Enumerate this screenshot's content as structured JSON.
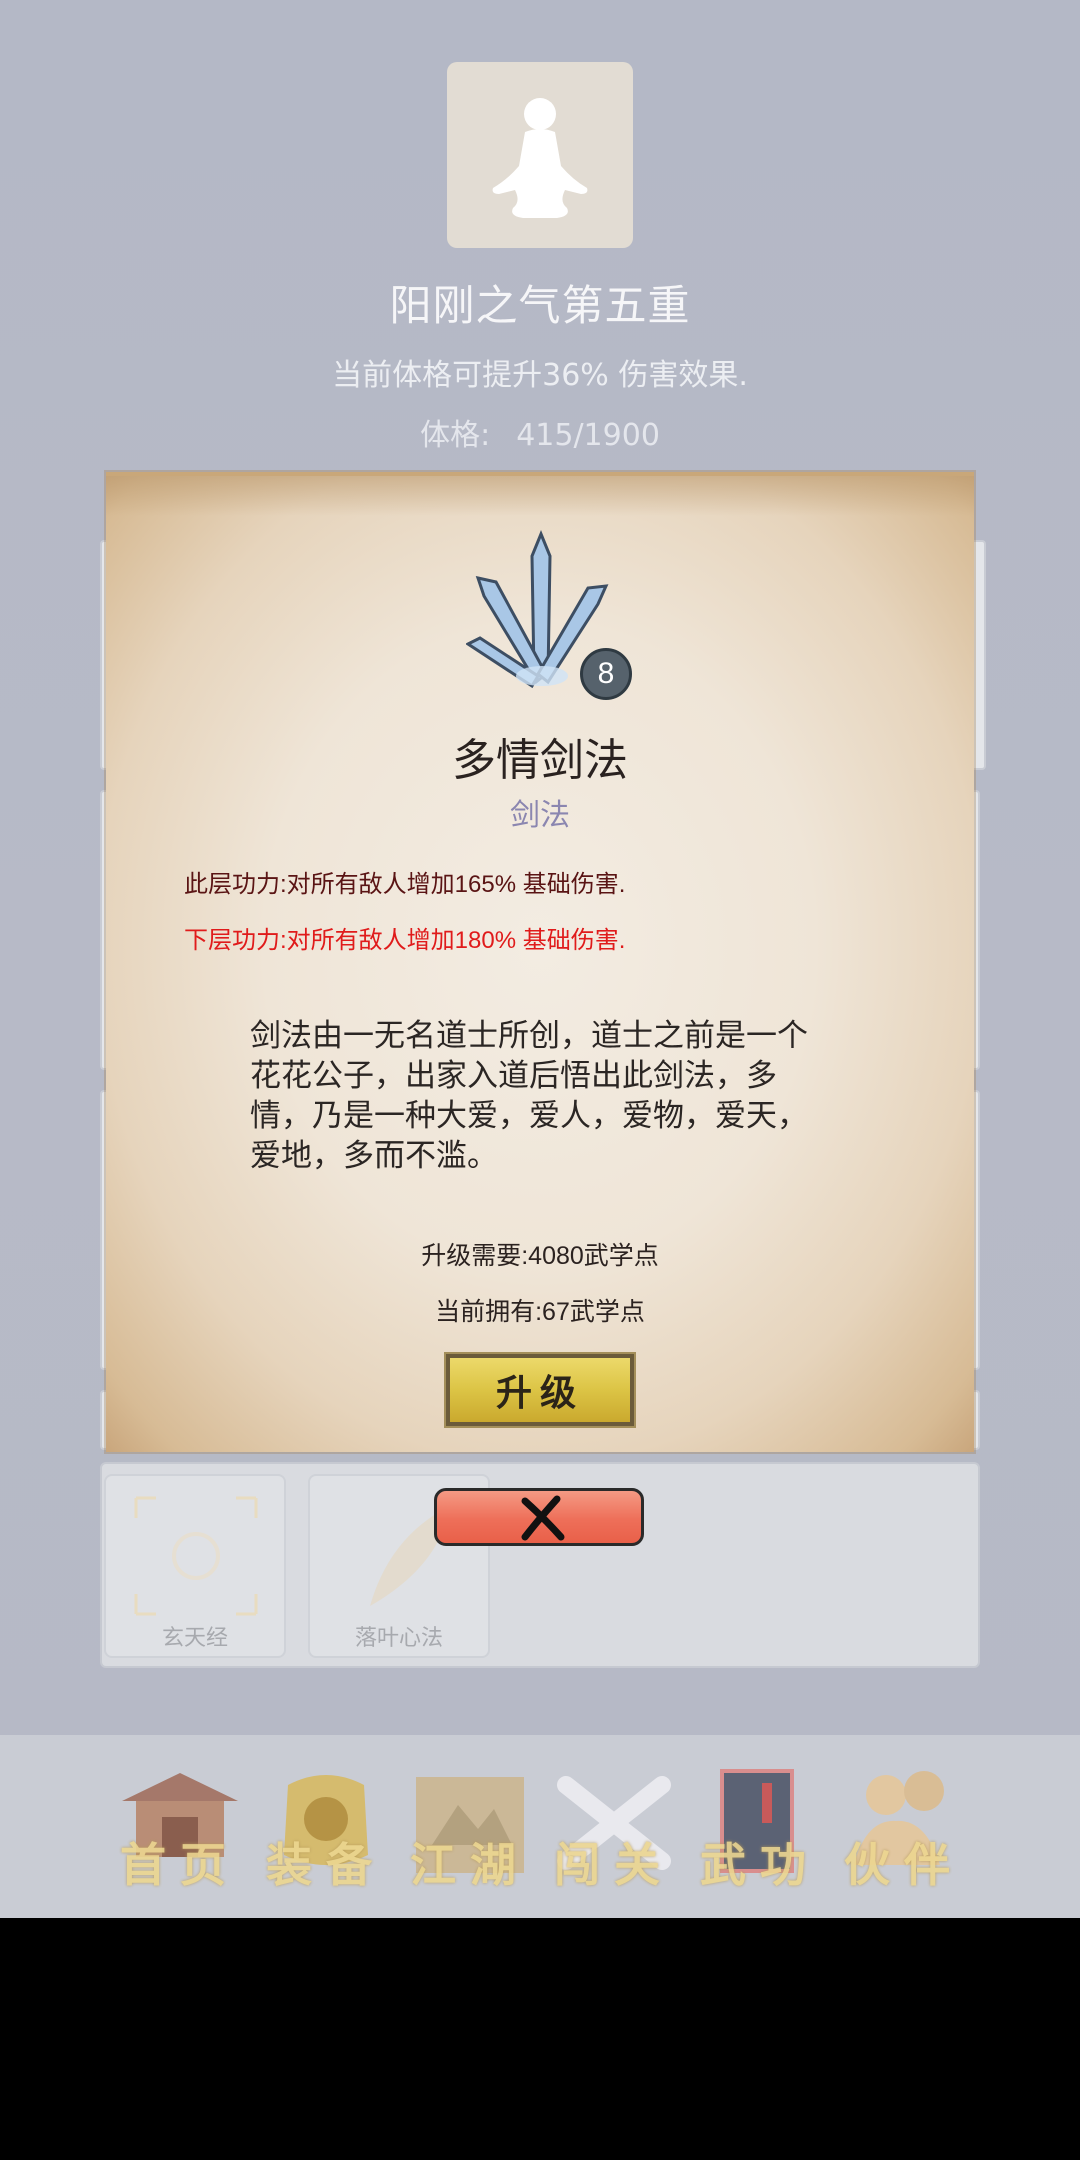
{
  "header": {
    "realm_title": "阳刚之气第五重",
    "realm_desc": "当前体格可提升36% 伤害效果.",
    "stat_label": "体格:",
    "stat_value": "415/1900",
    "avatar_icon": "meditation-figure-icon"
  },
  "skill_popup": {
    "level": "8",
    "name": "多情剑法",
    "type": "剑法",
    "current_power": "此层功力:对所有敌人增加165% 基础伤害.",
    "next_power": "下层功力:对所有敌人增加180% 基础伤害.",
    "lore": "剑法由一无名道士所创，道士之前是一个花花公子，出家入道后悟出此剑法，多情，乃是一种大爱，爱人，爱物，爱天，爱地，多而不滥。",
    "upgrade_need": "升级需要:4080武学点",
    "owned_points": "当前拥有:67武学点",
    "upgrade_label": "升级",
    "icon": "sword-fan-icon",
    "colors": {
      "current_power": "#5a1414",
      "next_power": "#e01b1b",
      "upgrade_button": "#dcc445"
    }
  },
  "close_button": {
    "icon": "close-x-icon",
    "color": "#ee6f59"
  },
  "tray": {
    "items": [
      {
        "label": "玄天经"
      },
      {
        "label": "落叶心法"
      }
    ]
  },
  "bottom_nav": {
    "items": [
      {
        "label": "首页",
        "icon": "pavilion-icon"
      },
      {
        "label": "装备",
        "icon": "armor-icon"
      },
      {
        "label": "江湖",
        "icon": "scroll-map-icon"
      },
      {
        "label": "闯关",
        "icon": "crossed-swords-icon"
      },
      {
        "label": "武功",
        "icon": "book-icon"
      },
      {
        "label": "伙伴",
        "icon": "companions-icon"
      }
    ]
  }
}
